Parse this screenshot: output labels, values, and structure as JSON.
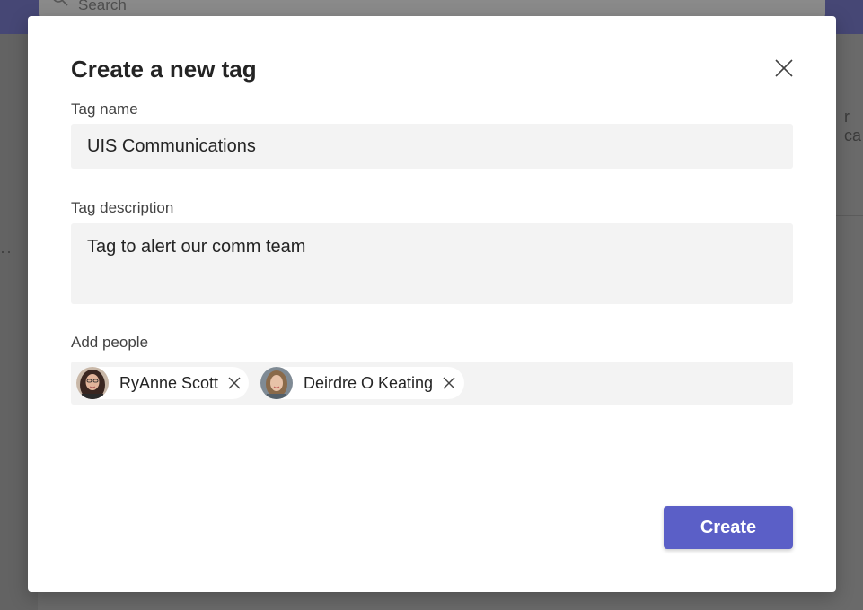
{
  "background": {
    "search_placeholder": "Search",
    "side_text": "r ca",
    "ellipsis": "··"
  },
  "dialog": {
    "title": "Create a new tag",
    "close_icon": "close-icon",
    "tag_name": {
      "label": "Tag name",
      "value": "UIS Communications"
    },
    "tag_description": {
      "label": "Tag description",
      "value": "Tag to alert our comm team"
    },
    "add_people": {
      "label": "Add people",
      "people": [
        {
          "name": "RyAnne Scott"
        },
        {
          "name": "Deirdre O Keating"
        }
      ]
    },
    "create_label": "Create"
  },
  "colors": {
    "accent": "#5b5fc7",
    "app_header": "#464775",
    "input_bg": "#f3f3f3"
  }
}
